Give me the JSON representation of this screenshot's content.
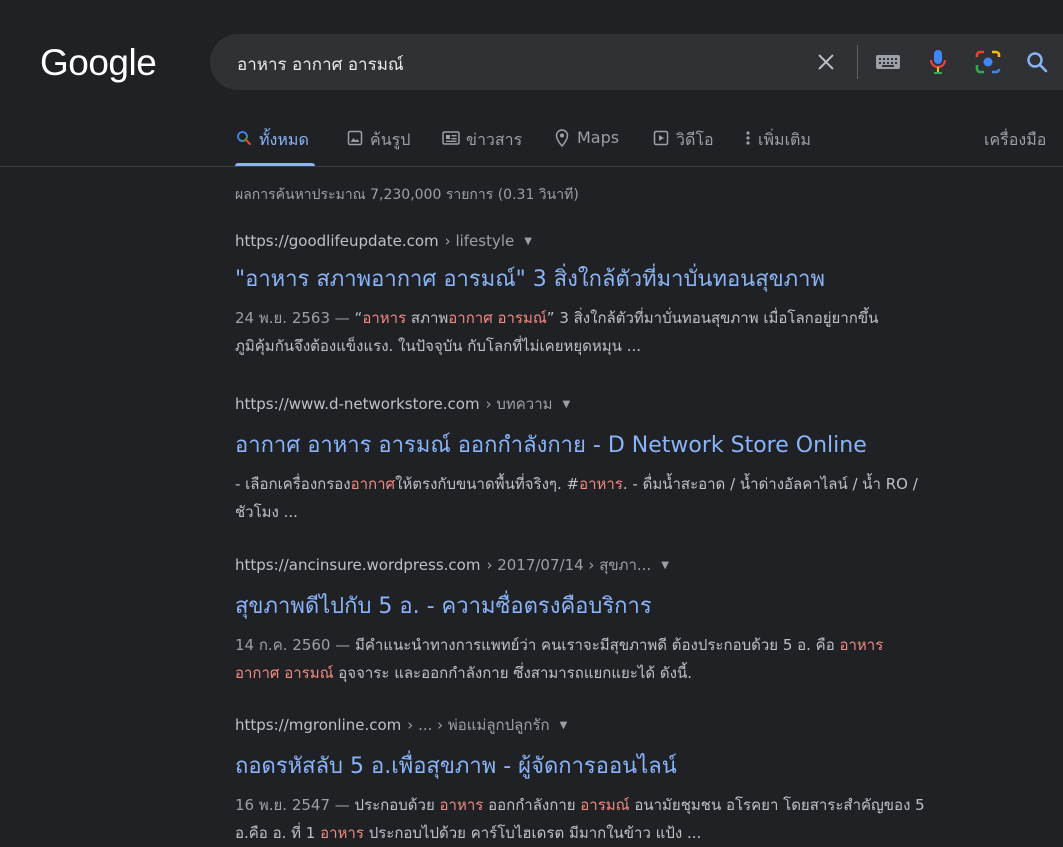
{
  "logo": "Google",
  "search": {
    "query": "อาหาร อากาศ อารมณ์"
  },
  "icons": [
    "clear-icon",
    "keyboard-icon",
    "mic-icon",
    "lens-icon",
    "search-icon"
  ],
  "tabs": [
    {
      "label": "ทั้งหมด",
      "icon": "search-icon",
      "active": true
    },
    {
      "label": "ค้นรูป",
      "icon": "image-icon"
    },
    {
      "label": "ข่าวสาร",
      "icon": "news-icon"
    },
    {
      "label": "Maps",
      "icon": "map-pin-icon"
    },
    {
      "label": "วิดีโอ",
      "icon": "video-icon"
    },
    {
      "label": "เพิ่มเติม",
      "icon": "more-vert-icon"
    }
  ],
  "tools_label": "เครื่องมือ",
  "stats": "ผลการค้นหาประมาณ 7,230,000 รายการ (0.31 วินาที)",
  "results": [
    {
      "url": "https://goodlifeupdate.com",
      "breadcrumb": "› lifestyle",
      "title": "\"อาหาร สภาพอากาศ อารมณ์\" 3 สิ่งใกล้ตัวที่มาบั่นทอนสุขภาพ",
      "snippet": {
        "date": "24 พ.ย. 2563 —",
        "line1": [
          {
            "t": " “"
          },
          {
            "t": "อาหาร",
            "hl": true
          },
          {
            "t": " สภาพ"
          },
          {
            "t": "อากาศ อารมณ์",
            "hl": true
          },
          {
            "t": "” 3 สิ่งใกล้ตัวที่มาบั่นทอนสุขภาพ เมื่อโลกอยู่ยากขึ้น"
          }
        ],
        "line2": [
          {
            "t": "ภูมิคุ้มกันจึงต้องแข็งแรง. ในปัจจุบัน กับโลกที่ไม่เคยหยุดหมุน ..."
          }
        ]
      }
    },
    {
      "url": "https://www.d-networkstore.com",
      "breadcrumb": "› บทความ",
      "title": "อากาศ อาหาร อารมณ์ ออกกำลังกาย - D Network Store Online",
      "snippet": {
        "date": "",
        "line1": [
          {
            "t": "- เลือกเครื่องกรอง"
          },
          {
            "t": "อากาศ",
            "hl": true
          },
          {
            "t": "ให้ตรงกับขนาดพื้นที่จริงๆ. #"
          },
          {
            "t": "อาหาร",
            "hl": true
          },
          {
            "t": ". - ดื่มน้ำสะอาด / น้ำด่างอัลคาไลน์ / น้ำ RO /"
          }
        ],
        "line2": [
          {
            "t": "ชัวโมง ..."
          }
        ]
      }
    },
    {
      "url": "https://ancinsure.wordpress.com",
      "breadcrumb": "› 2017/07/14 › สุขภา...",
      "title": "สุขภาพดีไปกับ 5 อ. - ความซื่อตรงคือบริการ",
      "snippet": {
        "date": "14 ก.ค. 2560 —",
        "line1": [
          {
            "t": " มีคำแนะนำทางการแพทย์ว่า คนเราจะมีสุขภาพดี ต้องประกอบด้วย 5 อ. คือ "
          },
          {
            "t": "อาหาร",
            "hl": true
          }
        ],
        "line2": [
          {
            "t": "อากาศ อารมณ์",
            "hl": true
          },
          {
            "t": " อุจจาระ และออกกำลังกาย ซึ่งสามารถแยกแยะได้ ดังนี้."
          }
        ]
      }
    },
    {
      "url": "https://mgronline.com",
      "breadcrumb": "› ... › พ่อแม่ลูกปลูกรัก",
      "title": "ถอดรหัสลับ 5 อ.เพื่อสุขภาพ - ผู้จัดการออนไลน์",
      "snippet": {
        "date": "16 พ.ย. 2547 —",
        "line1": [
          {
            "t": " ประกอบด้วย "
          },
          {
            "t": "อาหาร",
            "hl": true
          },
          {
            "t": " ออกกำลังกาย "
          },
          {
            "t": "อารมณ์",
            "hl": true
          },
          {
            "t": " อนามัยชุมชน อโรคยา โดยสาระสำคัญของ 5"
          }
        ],
        "line2": [
          {
            "t": "อ.คือ อ. ที่ 1 "
          },
          {
            "t": "อาหาร",
            "hl": true
          },
          {
            "t": " ประกอบไปด้วย คาร์โบไฮเดรต มีมากในข้าว แป้ง ..."
          }
        ]
      }
    }
  ]
}
